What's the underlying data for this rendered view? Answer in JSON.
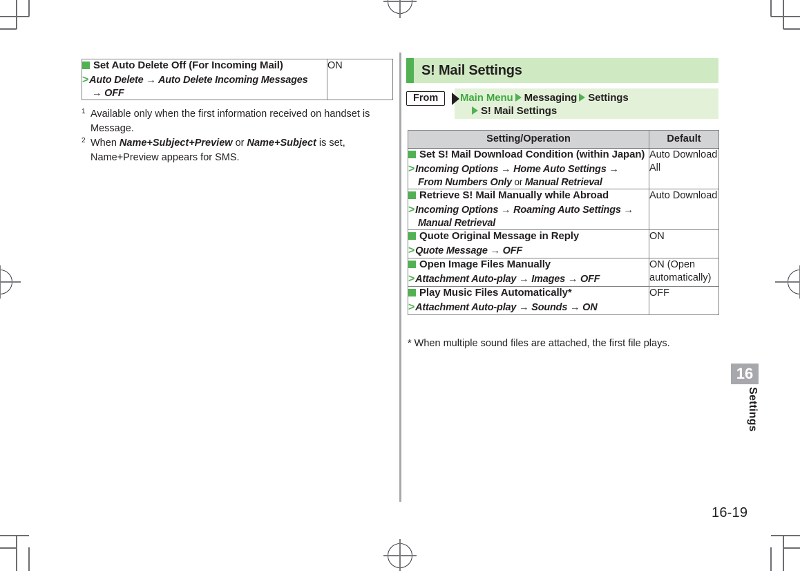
{
  "page": {
    "number": "16-19",
    "chapter_number": "16",
    "chapter_label": "Settings"
  },
  "left_column": {
    "table": {
      "rows": [
        {
          "title": "Set Auto Delete Off (For Incoming Mail)",
          "operation_line1": "Auto Delete → Auto Delete Incoming Messages",
          "operation_line2": "→ OFF",
          "default": "ON"
        }
      ]
    },
    "footnotes": [
      {
        "mark": "1",
        "line1_pre": "Available only when the first information received on handset is Message.",
        "bold1": "",
        "mid": "",
        "bold2": "",
        "line1_post": "",
        "line2": ""
      },
      {
        "mark": "2",
        "line1_pre": "When ",
        "bold1": "Name+Subject+Preview",
        "mid": " or ",
        "bold2": "Name+Subject",
        "line1_post": " is set,",
        "line2": "Name+Preview appears for SMS."
      }
    ]
  },
  "right_column": {
    "section_title": "S! Mail Settings",
    "breadcrumb": {
      "from_label": "From",
      "crumb1": "Main Menu",
      "crumb2": "Messaging",
      "crumb3": "Settings",
      "crumb4": "S! Mail Settings"
    },
    "table": {
      "headers": {
        "setting": "Setting/Operation",
        "default": "Default"
      },
      "rows": [
        {
          "title": "Set S! Mail Download Condition (within Japan)",
          "operation_line1": "Incoming Options → Home Auto Settings →",
          "operation_line2_pre": "From Numbers Only",
          "operation_line2_mid": " or ",
          "operation_line2_post": "Manual Retrieval",
          "default": "Auto Download All"
        },
        {
          "title": "Retrieve S! Mail Manually while Abroad",
          "operation_line1": "Incoming Options → Roaming Auto Settings →",
          "operation_line2_pre": "Manual Retrieval",
          "operation_line2_mid": "",
          "operation_line2_post": "",
          "default": "Auto Download"
        },
        {
          "title": "Quote Original Message in Reply",
          "operation_line1": "Quote Message → OFF",
          "operation_line2_pre": "",
          "operation_line2_mid": "",
          "operation_line2_post": "",
          "default": "ON"
        },
        {
          "title": "Open Image Files Manually",
          "operation_line1": "Attachment Auto-play → Images → OFF",
          "operation_line2_pre": "",
          "operation_line2_mid": "",
          "operation_line2_post": "",
          "default": "ON (Open automatically)"
        },
        {
          "title": "Play Music Files Automatically*",
          "operation_line1": "Attachment Auto-play → Sounds → ON",
          "operation_line2_pre": "",
          "operation_line2_mid": "",
          "operation_line2_post": "",
          "default": "OFF"
        }
      ]
    },
    "star_note": "* When multiple sound files are attached, the first file plays."
  },
  "colors": {
    "accent_green": "#52b153",
    "header_green": "#cfe9c2",
    "crumb_green": "#e3f1d9",
    "table_header_gray": "#d2d3d5",
    "tab_gray": "#a6a8ab"
  }
}
